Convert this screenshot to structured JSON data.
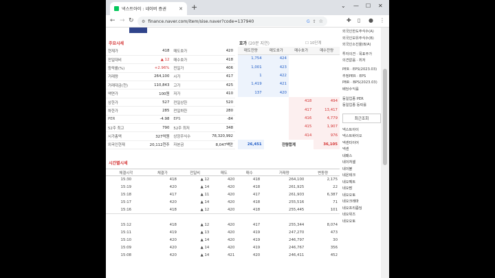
{
  "browser": {
    "tab_title": "넥스트아이 : 네이버 증권",
    "url": "finance.naver.com/item/sise.naver?code=137940"
  },
  "market_price": {
    "title": "주요시세",
    "rows": [
      {
        "l1": "현재가",
        "v1": "418",
        "l2": "매도호가",
        "v2": "420"
      },
      {
        "l1": "전일대비",
        "v1": "▲ 12",
        "l2": "매수호가",
        "v2": "418"
      },
      {
        "l1": "등락률(%)",
        "v1": "+2.96%",
        "l2": "전일가",
        "v2": "406"
      },
      {
        "l1": "거래량",
        "v1": "264,100",
        "l2": "시가",
        "v2": "417"
      },
      {
        "l1": "거래대금(천)",
        "v1": "110,843",
        "l2": "고가",
        "v2": "425"
      },
      {
        "l1": "액면가",
        "v1": "100원",
        "l2": "저가",
        "v2": "410"
      },
      {
        "l1": "상한가",
        "v1": "527",
        "l2": "전일상한",
        "v2": "520"
      },
      {
        "l1": "하한가",
        "v1": "285",
        "l2": "전일하한",
        "v2": "280"
      },
      {
        "l1": "PER",
        "v1": "-4.98",
        "l2": "EPS",
        "v2": "-84"
      },
      {
        "l1": "52주 최고",
        "v1": "790",
        "l2": "52주 최저",
        "v2": "348"
      },
      {
        "l1": "시가총액",
        "v1": "327억원",
        "l2": "상장주식수",
        "v2": "78,320,992"
      },
      {
        "l1": "외국인현재",
        "v1": "20,112천주",
        "l2": "자본금",
        "v2": "8,047백만"
      }
    ]
  },
  "hoga": {
    "title": "호가",
    "note": "(20분 지연)",
    "units": "10단계",
    "headers": [
      "매도잔량",
      "매도호가",
      "매수호가",
      "매수잔량"
    ],
    "asks": [
      {
        "qty": "1,754",
        "price": "424"
      },
      {
        "qty": "1,001",
        "price": "423"
      },
      {
        "qty": "1",
        "price": "422"
      },
      {
        "qty": "1,419",
        "price": "421"
      },
      {
        "qty": "137",
        "price": "420"
      }
    ],
    "bids": [
      {
        "price": "418",
        "qty": "494"
      },
      {
        "price": "417",
        "qty": "13,417"
      },
      {
        "price": "416",
        "qty": "4,779"
      },
      {
        "price": "415",
        "qty": "1,907"
      },
      {
        "price": "414",
        "qty": "976"
      }
    ],
    "total": {
      "ask": "26,451",
      "label": "잔량합계",
      "bid": "36,105"
    }
  },
  "trades": {
    "title": "시간별시세",
    "headers": [
      "체결시각",
      "체결가",
      "전일비",
      "매도",
      "매수",
      "거래량",
      "변동량"
    ],
    "group1": [
      {
        "t": "15:30",
        "p": "418",
        "d": "▲ 12",
        "s": "420",
        "b": "418",
        "v": "264,100",
        "c": "2,175"
      },
      {
        "t": "15:19",
        "p": "420",
        "d": "▲ 14",
        "s": "420",
        "b": "418",
        "v": "261,925",
        "c": "22"
      },
      {
        "t": "15:18",
        "p": "417",
        "d": "▲ 11",
        "s": "420",
        "b": "417",
        "v": "261,903",
        "c": "6,387"
      },
      {
        "t": "15:17",
        "p": "420",
        "d": "▲ 14",
        "s": "420",
        "b": "418",
        "v": "255,516",
        "c": "71"
      },
      {
        "t": "15:16",
        "p": "418",
        "d": "▲ 12",
        "s": "420",
        "b": "418",
        "v": "255,445",
        "c": "101"
      }
    ],
    "group2": [
      {
        "t": "15:12",
        "p": "418",
        "d": "▲ 12",
        "s": "420",
        "b": "417",
        "v": "255,344",
        "c": "8,074"
      },
      {
        "t": "15:11",
        "p": "419",
        "d": "▲ 13",
        "s": "420",
        "b": "419",
        "v": "247,270",
        "c": "473"
      },
      {
        "t": "15:10",
        "p": "420",
        "d": "▲ 14",
        "s": "420",
        "b": "419",
        "v": "246,797",
        "c": "30"
      },
      {
        "t": "15:09",
        "p": "420",
        "d": "▲ 14",
        "s": "420",
        "b": "419",
        "v": "246,767",
        "c": "356"
      },
      {
        "t": "15:08",
        "p": "420",
        "d": "▲ 14",
        "s": "421",
        "b": "420",
        "v": "246,411",
        "c": "452"
      }
    ]
  },
  "right": {
    "lines": [
      "외국인한도주식수(A)",
      "외국인보유주식수(B)",
      "외국인소진율(B/A)",
      "투자의견 · 목표주가",
      "의견없음 · 최저",
      "PER · EPS(2023.03)",
      "추정PER · EPS",
      "PBR · BPS(2023.03)",
      "배당수익률",
      "동일업종 PER",
      "동일업종 등락률"
    ],
    "recent_title": "최근조회",
    "recent": [
      "넥스트아이",
      "넥스트바이오",
      "넥센타이어",
      "넥센",
      "네패스",
      "네이처셀",
      "네이블",
      "네온테크",
      "네오펙트",
      "네오팜",
      "네오오토",
      "네오크레마",
      "네오프리즘딩",
      "네오위즈",
      "네오오토"
    ]
  },
  "colors": {
    "up": "#d32f2f",
    "down": "#1e5bc6",
    "ask_bg": "#edf3fc",
    "bid_bg": "#fcefef"
  }
}
